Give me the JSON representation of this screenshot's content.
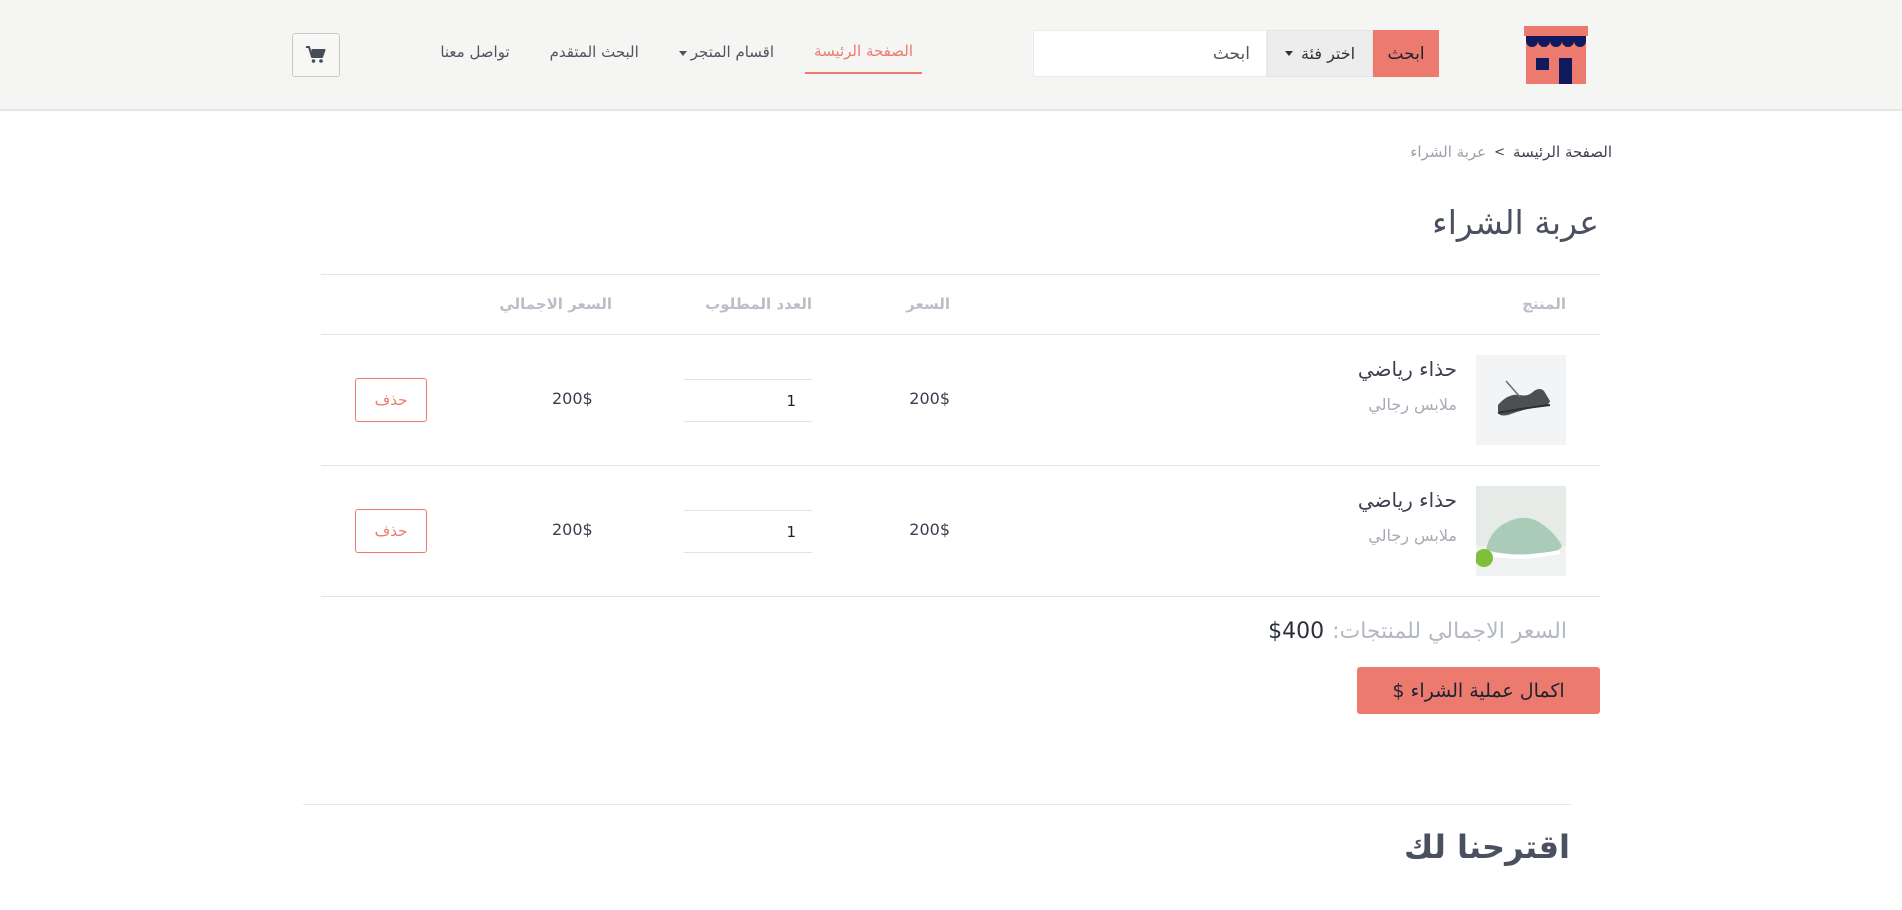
{
  "header": {
    "search": {
      "placeholder": "ابحث",
      "category_label": "اختر فئة",
      "button_label": "ابحث"
    },
    "nav": [
      {
        "label": "الصفحة الرئيسة",
        "active": true
      },
      {
        "label": "اقسام المتجر",
        "dropdown": true
      },
      {
        "label": "البحث المتقدم"
      },
      {
        "label": "تواصل معنا"
      }
    ],
    "cart_icon": "shopping-cart-icon",
    "accent_color": "#ec7a6f",
    "logo_colors": {
      "awning": "#10195e",
      "body": "#ec7a6f"
    }
  },
  "breadcrumb": {
    "home": "الصفحة الرئيسة",
    "separator": ">",
    "current": "عربة الشراء"
  },
  "page_title": "عربة الشراء",
  "cart": {
    "columns": {
      "product": "المنتج",
      "price": "السعر",
      "quantity": "العدد المطلوب",
      "total": "السعر الاجمالي"
    },
    "items": [
      {
        "name": "حذاء رياضي",
        "category": "ملابس رجالي",
        "price": "200$",
        "quantity": "1",
        "total": "200$",
        "delete_label": "حذف",
        "image": "dark-sneaker"
      },
      {
        "name": "حذاء رياضي",
        "category": "ملابس رجالي",
        "price": "200$",
        "quantity": "1",
        "total": "200$",
        "delete_label": "حذف",
        "image": "mint-sneaker"
      }
    ],
    "grand_total_label": "السعر الاجمالي للمنتجات:",
    "grand_total_value": "$400",
    "checkout_label": "اكمال عملية الشراء $"
  },
  "suggestions_title": "اقترحنا لك"
}
